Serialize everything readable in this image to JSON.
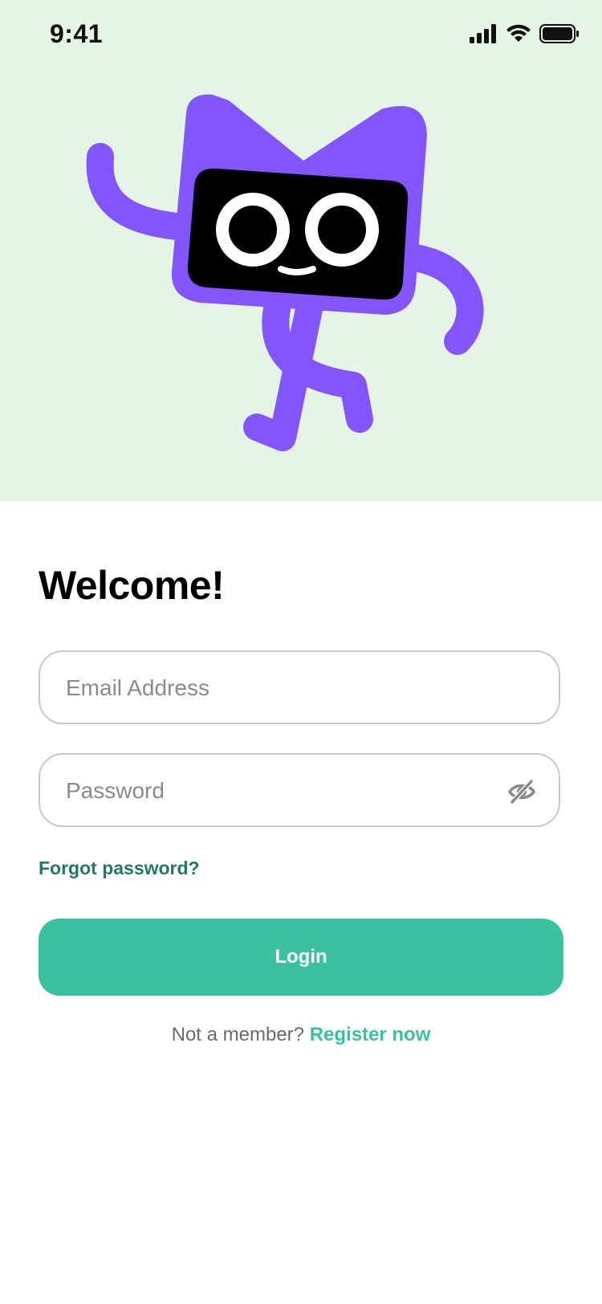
{
  "status_bar": {
    "time": "9:41",
    "icons": [
      "cellular-signal-icon",
      "wifi-icon",
      "battery-icon"
    ]
  },
  "hero": {
    "background": "#e6f4e8",
    "illustration": "mascot-illustration",
    "mascot_color": "#8255ff"
  },
  "login": {
    "title": "Welcome!",
    "email_placeholder": "Email Address",
    "email_value": "",
    "password_placeholder": "Password",
    "password_value": "",
    "password_toggle_icon": "eye-off-icon",
    "forgot_password": "Forgot password?",
    "login_button": "Login",
    "register_prompt": "Not a member?",
    "register_link": "Register now"
  },
  "colors": {
    "accent": "#3cc1a0",
    "link_dark": "#237b5c"
  }
}
